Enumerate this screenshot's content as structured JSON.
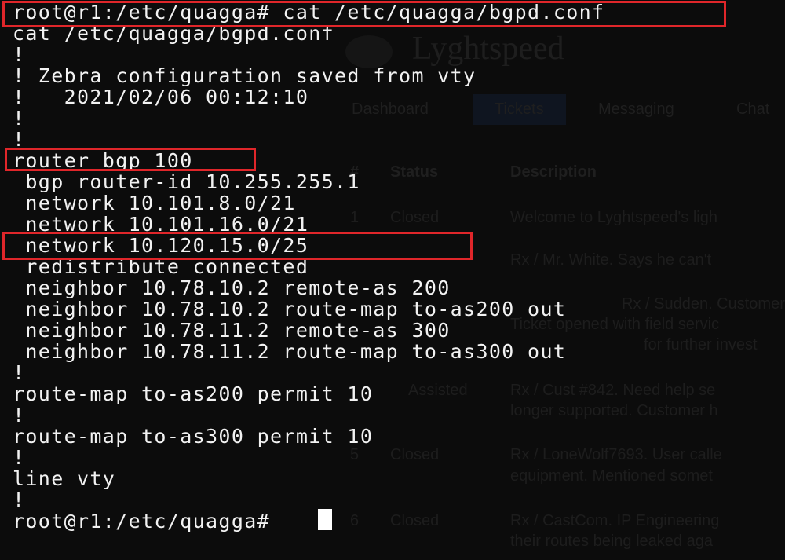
{
  "terminal": {
    "lines": [
      "root@r1:/etc/quagga# cat /etc/quagga/bgpd.conf",
      "cat /etc/quagga/bgpd.conf",
      "!",
      "! Zebra configuration saved from vty",
      "!   2021/02/06 00:12:10",
      "!",
      "!",
      "router bgp 100",
      " bgp router-id 10.255.255.1",
      " network 10.101.8.0/21",
      " network 10.101.16.0/21",
      " network 10.120.15.0/25",
      " redistribute connected",
      " neighbor 10.78.10.2 remote-as 200",
      " neighbor 10.78.10.2 route-map to-as200 out",
      " neighbor 10.78.11.2 remote-as 300",
      " neighbor 10.78.11.2 route-map to-as300 out",
      "!",
      "route-map to-as200 permit 10",
      "!",
      "route-map to-as300 permit 10",
      "!",
      "line vty",
      "!",
      "root@r1:/etc/quagga# "
    ],
    "highlight_color": "#e0262a",
    "text_color": "#f2f2f2",
    "background_color": "#0c0c0c"
  },
  "background_page": {
    "brand": "Lyghtspeed",
    "tabs": [
      "Dashboard",
      "Tickets",
      "Messaging",
      "Chat"
    ],
    "headers": [
      "#",
      "Status",
      "Description"
    ],
    "rows": [
      {
        "num": "1",
        "status": "Closed",
        "desc": "Welcome to Lyghtspeed's ligh"
      },
      {
        "num": "",
        "status": "",
        "desc": "Rx / Mr. White. Says he can't"
      },
      {
        "num": "",
        "status": "",
        "desc": "Rx / Sudden. Customer"
      },
      {
        "num": "",
        "status": "",
        "desc": "Ticket opened with field servic"
      },
      {
        "num": "",
        "status": "",
        "desc": "for further invest"
      },
      {
        "num": "",
        "status": "Assisted",
        "desc": "Rx / Cust #842. Need help se"
      },
      {
        "num": "",
        "status": "",
        "desc": "longer supported. Customer h"
      },
      {
        "num": "5",
        "status": "Closed",
        "desc": "Rx / LoneWolf7693. User calle"
      },
      {
        "num": "",
        "status": "",
        "desc": "equipment. Mentioned somet"
      },
      {
        "num": "6",
        "status": "Closed",
        "desc": "Rx / CastCom. IP Engineering"
      },
      {
        "num": "",
        "status": "",
        "desc": "their routes being leaked aga"
      }
    ]
  }
}
